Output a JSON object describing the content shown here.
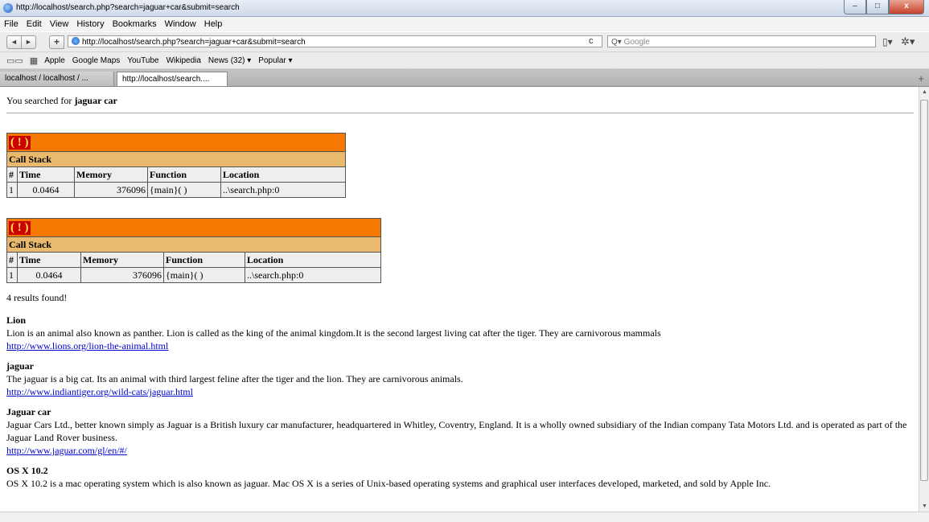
{
  "window": {
    "title": "http://localhost/search.php?search=jaguar+car&submit=search",
    "controls": {
      "minimize": "–",
      "maximize": "□",
      "close": "x"
    }
  },
  "menu": [
    "File",
    "Edit",
    "View",
    "History",
    "Bookmarks",
    "Window",
    "Help"
  ],
  "nav": {
    "back": "◄",
    "forward": "►",
    "add": "+",
    "url": "http://localhost/search.php?search=jaguar+car&submit=search",
    "reload": "c",
    "search_placeholder": "Google",
    "search_prefix": "Q▾"
  },
  "bookmarks": [
    "Apple",
    "Google Maps",
    "YouTube",
    "Wikipedia",
    "News (32) ▾",
    "Popular ▾"
  ],
  "tabs": [
    "localhost / localhost / ...",
    "http://localhost/search...."
  ],
  "page": {
    "searched_prefix": "You searched for ",
    "searched_term": "jaguar car",
    "errors": [
      {
        "icon": "( ! )",
        "call_stack": "Call Stack",
        "headers": [
          "#",
          "Time",
          "Memory",
          "Function",
          "Location"
        ],
        "row": [
          "1",
          "0.0464",
          "376096",
          "{main}( )",
          "..\\search.php:0"
        ]
      },
      {
        "icon": "( ! )",
        "call_stack": "Call Stack",
        "headers": [
          "#",
          "Time",
          "Memory",
          "Function",
          "Location"
        ],
        "row": [
          "1",
          "0.0464",
          "376096",
          "{main}( )",
          "..\\search.php:0"
        ]
      }
    ],
    "results_count": "4 results found!",
    "results": [
      {
        "title": "Lion",
        "desc": "Lion is an animal also known as panther. Lion is called as the king of the animal kingdom.It is the second largest living cat after the tiger. They are carnivorous mammals",
        "url": "http://www.lions.org/lion-the-animal.html"
      },
      {
        "title": "jaguar",
        "desc": "The jaguar is a big cat. Its an animal with third largest feline after the tiger and the lion. They are carnivorous animals.",
        "url": "http://www.indiantiger.org/wild-cats/jaguar.html"
      },
      {
        "title": "Jaguar car",
        "desc": "Jaguar Cars Ltd., better known simply as Jaguar is a British luxury car manufacturer, headquartered in Whitley, Coventry, England. It is a wholly owned subsidiary of the Indian company Tata Motors Ltd. and is operated as part of the Jaguar Land Rover business.",
        "url": "http://www.jaguar.com/gl/en/#/"
      },
      {
        "title": "OS X 10.2",
        "desc": "OS X 10.2 is a mac operating system which is also known as jaguar. Mac OS X is a series of Unix-based operating systems and graphical user interfaces developed, marketed, and sold by Apple Inc.",
        "url": ""
      }
    ]
  },
  "colors": {
    "error_bar": "#f57900",
    "call_stack": "#e9b96e",
    "link": "#0000cc"
  }
}
